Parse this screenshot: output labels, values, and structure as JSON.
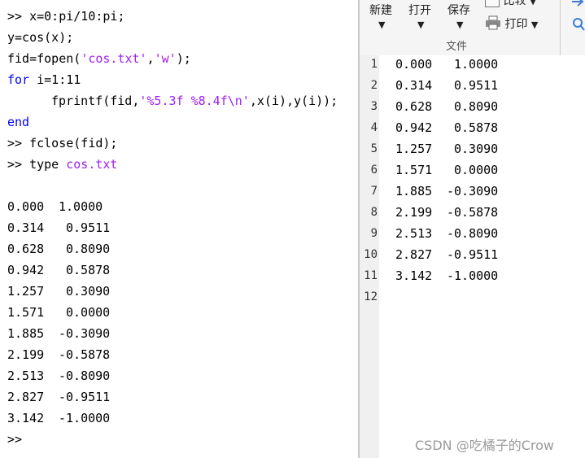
{
  "command_window": {
    "prompt": ">>",
    "line1": "x=0:pi/10:pi;",
    "line2": "y=cos(x);",
    "line3_pre": "fid=fopen(",
    "line3_str1": "'cos.txt'",
    "line3_mid": ",",
    "line3_str2": "'w'",
    "line3_post": ");",
    "line4_kw": "for",
    "line4_rest": " i=1:11",
    "line5_pre": "fprintf(fid,",
    "line5_str": "'%5.3f %8.4f\\n'",
    "line5_post": ",x(i),y(i));",
    "line6_kw": "end",
    "line7": "fclose(fid);",
    "line8_pre": "type ",
    "line8_file": "cos.txt",
    "output": [
      {
        "x": "0.000",
        "y": "1.0000"
      },
      {
        "x": "0.314",
        "y": "0.9511"
      },
      {
        "x": "0.628",
        "y": "0.8090"
      },
      {
        "x": "0.942",
        "y": "0.5878"
      },
      {
        "x": "1.257",
        "y": "0.3090"
      },
      {
        "x": "1.571",
        "y": "0.0000"
      },
      {
        "x": "1.885",
        "y": "-0.3090"
      },
      {
        "x": "2.199",
        "y": "-0.5878"
      },
      {
        "x": "2.513",
        "y": "-0.8090"
      },
      {
        "x": "2.827",
        "y": "-0.9511"
      },
      {
        "x": "3.142",
        "y": "-1.0000"
      }
    ]
  },
  "toolbar": {
    "new_label": "新建",
    "open_label": "打开",
    "save_label": "保存",
    "compare_label": "比较",
    "print_label": "打印",
    "group_label": "文件"
  },
  "editor": {
    "line_numbers": [
      "1",
      "2",
      "3",
      "4",
      "5",
      "6",
      "7",
      "8",
      "9",
      "10",
      "11",
      "12"
    ],
    "rows": [
      {
        "x": "0.000",
        "y": "1.0000"
      },
      {
        "x": "0.314",
        "y": "0.9511"
      },
      {
        "x": "0.628",
        "y": "0.8090"
      },
      {
        "x": "0.942",
        "y": "0.5878"
      },
      {
        "x": "1.257",
        "y": "0.3090"
      },
      {
        "x": "1.571",
        "y": "0.0000"
      },
      {
        "x": "1.885",
        "y": "-0.3090"
      },
      {
        "x": "2.199",
        "y": "-0.5878"
      },
      {
        "x": "2.513",
        "y": "-0.8090"
      },
      {
        "x": "2.827",
        "y": "-0.9511"
      },
      {
        "x": "3.142",
        "y": "-1.0000"
      }
    ]
  },
  "watermark": "CSDN @吃橘子的Crow",
  "icons": [
    "dropdown-arrow-icon",
    "compare-icon",
    "printer-icon",
    "search-icon",
    "arrow-icon"
  ]
}
